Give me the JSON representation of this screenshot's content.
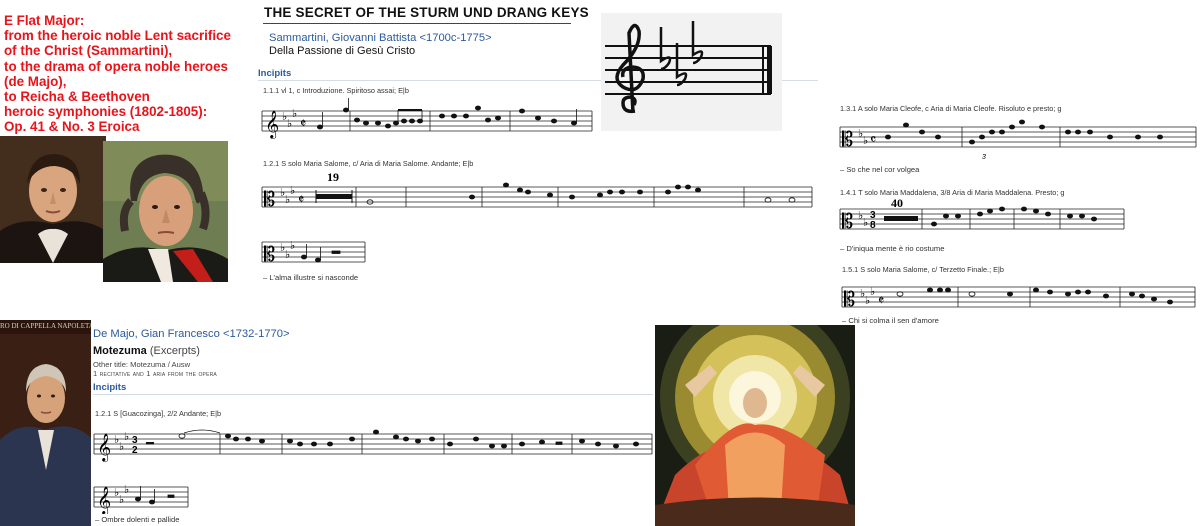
{
  "intro": {
    "lines": [
      "E Flat Major:",
      "from the heroic noble Lent sacrifice",
      "of the Christ (Sammartini),",
      "to the drama of opera noble heroes",
      "(de Majo),",
      "to Reicha & Beethoven",
      "heroic symphonies (1802-1805):",
      "Op. 41 & No. 3 Eroica"
    ]
  },
  "page_title": "THE SECRET OF THE STURM UND DRANG KEYS",
  "sammartini": {
    "composer": "Sammartini, Giovanni Battista <1700c-1775>",
    "work": "Della Passione di Gesù Cristo",
    "incipits_label": "Incipits",
    "incipits": [
      {
        "label": "1.1.1 vl 1, c Introduzione. Spiritoso assai; E|b",
        "lyric": ""
      },
      {
        "label": "1.2.1 S solo Maria Salome, c/ Aria di Maria Salome. Andante; E|b",
        "rest_count": "19",
        "lyric": "– L'alma illustre si nasconde"
      },
      {
        "label": "1.3.1 A solo Maria Cleofe, c Aria di Maria Cleofe. Risoluto e presto; g",
        "lyric": "– So che nel cor volgea"
      },
      {
        "label": "1.4.1 T solo Maria Maddalena, 3/8 Aria di Maria Maddalena. Presto; g",
        "rest_count": "40",
        "lyric": "– D'iniqua mente è rio costume"
      },
      {
        "label": "1.5.1 S solo Maria Salome, c/ Terzetto Finale.; E|b",
        "lyric": "– Chi si colma il sen d'amore"
      }
    ]
  },
  "demajo": {
    "composer": "De Majo, Gian Francesco <1732-1770>",
    "work_title": "Motezuma",
    "work_suffix": " (Excerpts)",
    "other_title": "Other title: Motezuma / Ausw",
    "description": "1 recitative and 1 aria from the opera",
    "incipits_label": "Incipits",
    "incipit": {
      "label": "1.2.1 S [Guacozinga], 2/2 Andante; E|b",
      "lyric": "– Ombre dolenti e pallide"
    }
  },
  "portrait_caption": "RO  DI CAPPELLA NAPOLETANO",
  "key_signature_image": {
    "key": "E-flat major",
    "clef": "treble",
    "flats": 3
  },
  "colors": {
    "intro_text": "#e8141b",
    "link_blue": "#2a5a9c",
    "title": "#111111"
  }
}
